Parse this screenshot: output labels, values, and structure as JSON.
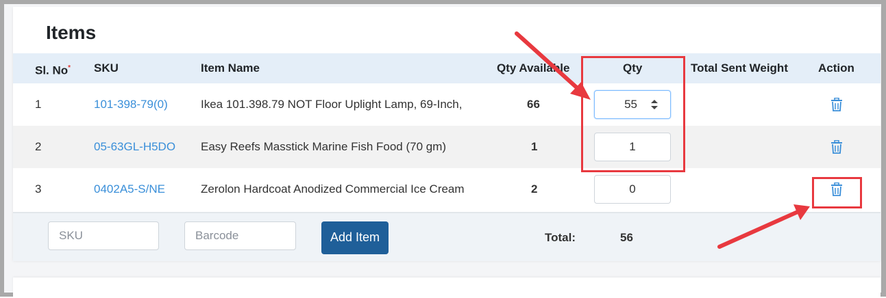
{
  "section_title": "Items",
  "columns": {
    "sl_no": "Sl. No",
    "required_marker": "*",
    "sku": "SKU",
    "item_name": "Item Name",
    "qty_available": "Qty Available",
    "qty": "Qty",
    "total_sent_weight": "Total Sent Weight",
    "action": "Action"
  },
  "rows": [
    {
      "sl": "1",
      "sku": "101-398-79(0)",
      "name": "Ikea 101.398.79 NOT Floor Uplight Lamp, 69-Inch,",
      "qty_available": "66",
      "qty": "55"
    },
    {
      "sl": "2",
      "sku": "05-63GL-H5DO",
      "name": "Easy Reefs Masstick Marine Fish Food (70 gm)",
      "qty_available": "1",
      "qty": "1"
    },
    {
      "sl": "3",
      "sku": "0402A5-S/NE",
      "name": "Zerolon Hardcoat Anodized Commercial Ice Cream",
      "qty_available": "2",
      "qty": "0"
    }
  ],
  "footer": {
    "sku_placeholder": "SKU",
    "barcode_placeholder": "Barcode",
    "add_item_label": "Add Item",
    "total_label": "Total:",
    "total_value": "56"
  },
  "colors": {
    "link": "#3a8fd9",
    "header_bg": "#e4eef8",
    "button_bg": "#1f5f99",
    "annotation_red": "#e8393f"
  },
  "icons": {
    "delete": "trash-icon",
    "stepper": "spinner-arrows-icon"
  }
}
